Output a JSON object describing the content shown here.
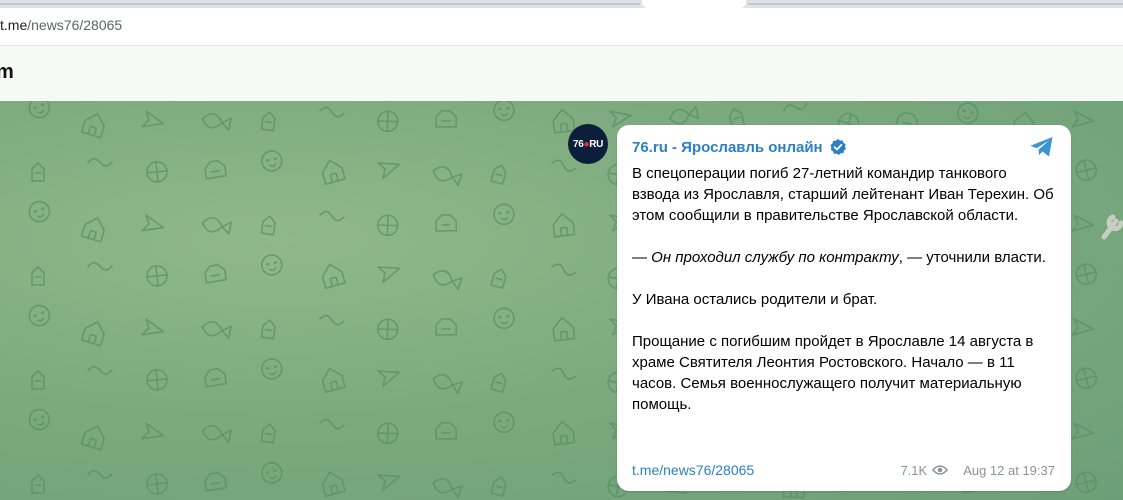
{
  "browser": {
    "url_host": "t.me",
    "url_path": "/news76/28065"
  },
  "topbar": {
    "title_fragment": "m"
  },
  "channel": {
    "avatar_text_a": "76",
    "avatar_text_b": "RU",
    "name": "76.ru - Ярославль онлайн",
    "verified_icon": "verified-check-icon",
    "accent_color": "#2b7fc4"
  },
  "message": {
    "p1": "В спецоперации погиб 27-летний командир танкового взвода из Ярославля, старший лейтенант Иван Терехин. Об этом сообщили в правительстве Ярославской области.",
    "p2_dash": "— ",
    "p2_italic": "Он проходил службу по контракту",
    "p2_rest": ", — уточнили власти.",
    "p3": "У Ивана остались родители и брат.",
    "p4": "Прощание с погибшим пройдет в Ярославле 14 августа в храме Святителя Леонтия Ростовского. Начало — в 11 часов. Семья военнослужащего получит материальную помощь."
  },
  "footer": {
    "link": "t.me/news76/28065",
    "views": "7.1K",
    "date": "Aug 12 at 19:37"
  }
}
